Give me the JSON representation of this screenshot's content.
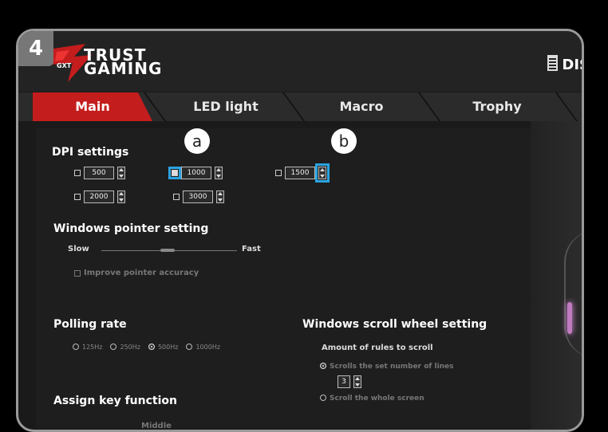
{
  "step_badge": "4",
  "brand": {
    "line1": "TRUST",
    "line2": "GAMING",
    "logo_text": "GXT"
  },
  "header_right": "DIS",
  "tabs": [
    {
      "label": "Main",
      "active": true
    },
    {
      "label": "LED light",
      "active": false
    },
    {
      "label": "Macro",
      "active": false
    },
    {
      "label": "Trophy",
      "active": false
    }
  ],
  "dpi": {
    "title": "DPI settings",
    "items": [
      {
        "value": "500",
        "checked": false
      },
      {
        "value": "1000",
        "checked": true
      },
      {
        "value": "1500",
        "checked": false
      },
      {
        "value": "2000",
        "checked": false
      },
      {
        "value": "3000",
        "checked": false
      }
    ]
  },
  "callouts": {
    "a": "a",
    "b": "b"
  },
  "pointer": {
    "title": "Windows pointer setting",
    "slow": "Slow",
    "fast": "Fast",
    "accuracy_label": "Improve pointer accuracy"
  },
  "polling": {
    "title": "Polling rate",
    "options": [
      "125Hz",
      "250Hz",
      "500Hz",
      "1000Hz"
    ],
    "selected": "500Hz"
  },
  "scroll": {
    "title": "Windows scroll wheel setting",
    "subtitle": "Amount of rules to scroll",
    "option1": "Scrolls the set number of lines",
    "lines_value": "3",
    "option2": "Scroll the whole screen"
  },
  "assign": {
    "title": "Assign key function",
    "partial_label": "Middle"
  },
  "colors": {
    "accent_red": "#c41d1d",
    "highlight_blue": "#2aa3e0"
  }
}
